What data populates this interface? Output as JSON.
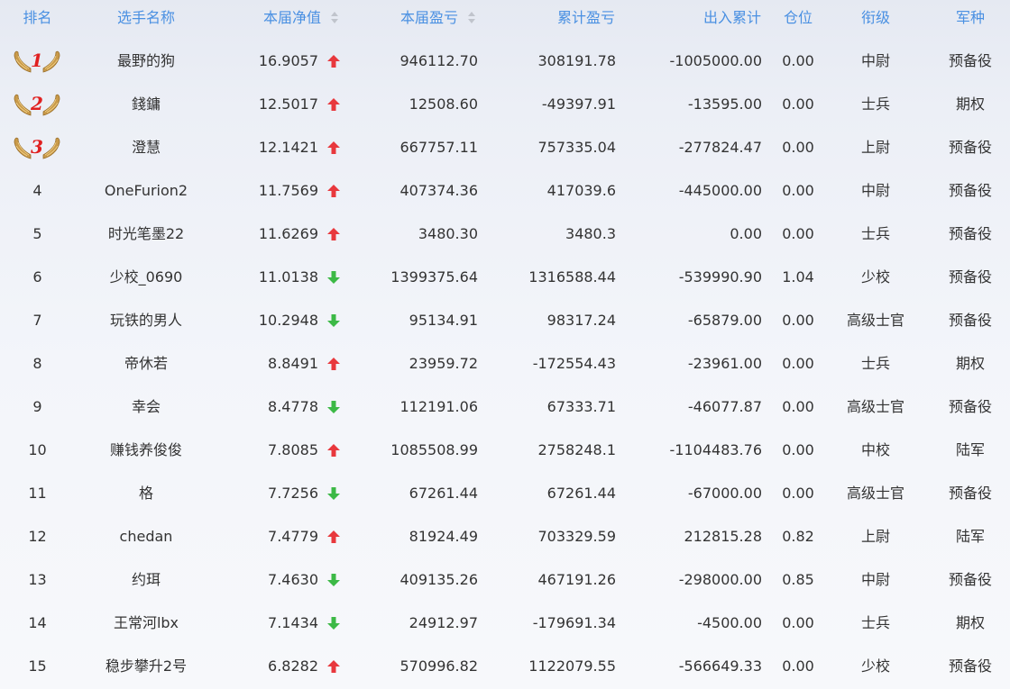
{
  "header": {
    "rank": "排名",
    "name": "选手名称",
    "nav": "本届净值",
    "period_pnl": "本届盈亏",
    "cum_pnl": "累计盈亏",
    "flow": "出入累计",
    "position": "仓位",
    "mil_rank": "衔级",
    "branch": "军种"
  },
  "colors": {
    "header_text": "#4a90e2",
    "up": "#e8383d",
    "down": "#3cb946",
    "medal_number": "#e02020",
    "wing": "#c99a4a"
  },
  "rows": [
    {
      "rank": "1",
      "name": "最野的狗",
      "nav": "16.9057",
      "trend": "up",
      "period_pnl": "946112.70",
      "cum_pnl": "308191.78",
      "flow": "-1005000.00",
      "position": "0.00",
      "mil_rank": "中尉",
      "branch": "预备役"
    },
    {
      "rank": "2",
      "name": "錢鏞",
      "nav": "12.5017",
      "trend": "up",
      "period_pnl": "12508.60",
      "cum_pnl": "-49397.91",
      "flow": "-13595.00",
      "position": "0.00",
      "mil_rank": "士兵",
      "branch": "期权"
    },
    {
      "rank": "3",
      "name": "澄慧",
      "nav": "12.1421",
      "trend": "up",
      "period_pnl": "667757.11",
      "cum_pnl": "757335.04",
      "flow": "-277824.47",
      "position": "0.00",
      "mil_rank": "上尉",
      "branch": "预备役"
    },
    {
      "rank": "4",
      "name": "OneFurion2",
      "nav": "11.7569",
      "trend": "up",
      "period_pnl": "407374.36",
      "cum_pnl": "417039.6",
      "flow": "-445000.00",
      "position": "0.00",
      "mil_rank": "中尉",
      "branch": "预备役"
    },
    {
      "rank": "5",
      "name": "时光笔墨22",
      "nav": "11.6269",
      "trend": "up",
      "period_pnl": "3480.30",
      "cum_pnl": "3480.3",
      "flow": "0.00",
      "position": "0.00",
      "mil_rank": "士兵",
      "branch": "预备役"
    },
    {
      "rank": "6",
      "name": "少校_0690",
      "nav": "11.0138",
      "trend": "down",
      "period_pnl": "1399375.64",
      "cum_pnl": "1316588.44",
      "flow": "-539990.90",
      "position": "1.04",
      "mil_rank": "少校",
      "branch": "预备役"
    },
    {
      "rank": "7",
      "name": "玩铁的男人",
      "nav": "10.2948",
      "trend": "down",
      "period_pnl": "95134.91",
      "cum_pnl": "98317.24",
      "flow": "-65879.00",
      "position": "0.00",
      "mil_rank": "高级士官",
      "branch": "预备役"
    },
    {
      "rank": "8",
      "name": "帝休若",
      "nav": "8.8491",
      "trend": "up",
      "period_pnl": "23959.72",
      "cum_pnl": "-172554.43",
      "flow": "-23961.00",
      "position": "0.00",
      "mil_rank": "士兵",
      "branch": "期权"
    },
    {
      "rank": "9",
      "name": "幸会",
      "nav": "8.4778",
      "trend": "down",
      "period_pnl": "112191.06",
      "cum_pnl": "67333.71",
      "flow": "-46077.87",
      "position": "0.00",
      "mil_rank": "高级士官",
      "branch": "预备役"
    },
    {
      "rank": "10",
      "name": "赚钱养俊俊",
      "nav": "7.8085",
      "trend": "up",
      "period_pnl": "1085508.99",
      "cum_pnl": "2758248.1",
      "flow": "-1104483.76",
      "position": "0.00",
      "mil_rank": "中校",
      "branch": "陆军"
    },
    {
      "rank": "11",
      "name": "格",
      "nav": "7.7256",
      "trend": "down",
      "period_pnl": "67261.44",
      "cum_pnl": "67261.44",
      "flow": "-67000.00",
      "position": "0.00",
      "mil_rank": "高级士官",
      "branch": "预备役"
    },
    {
      "rank": "12",
      "name": "chedan",
      "nav": "7.4779",
      "trend": "up",
      "period_pnl": "81924.49",
      "cum_pnl": "703329.59",
      "flow": "212815.28",
      "position": "0.82",
      "mil_rank": "上尉",
      "branch": "陆军"
    },
    {
      "rank": "13",
      "name": "约珥",
      "nav": "7.4630",
      "trend": "down",
      "period_pnl": "409135.26",
      "cum_pnl": "467191.26",
      "flow": "-298000.00",
      "position": "0.85",
      "mil_rank": "中尉",
      "branch": "预备役"
    },
    {
      "rank": "14",
      "name": "王常河lbx",
      "nav": "7.1434",
      "trend": "down",
      "period_pnl": "24912.97",
      "cum_pnl": "-179691.34",
      "flow": "-4500.00",
      "position": "0.00",
      "mil_rank": "士兵",
      "branch": "期权"
    },
    {
      "rank": "15",
      "name": "稳步攀升2号",
      "nav": "6.8282",
      "trend": "up",
      "period_pnl": "570996.82",
      "cum_pnl": "1122079.55",
      "flow": "-566649.33",
      "position": "0.00",
      "mil_rank": "少校",
      "branch": "预备役"
    }
  ]
}
